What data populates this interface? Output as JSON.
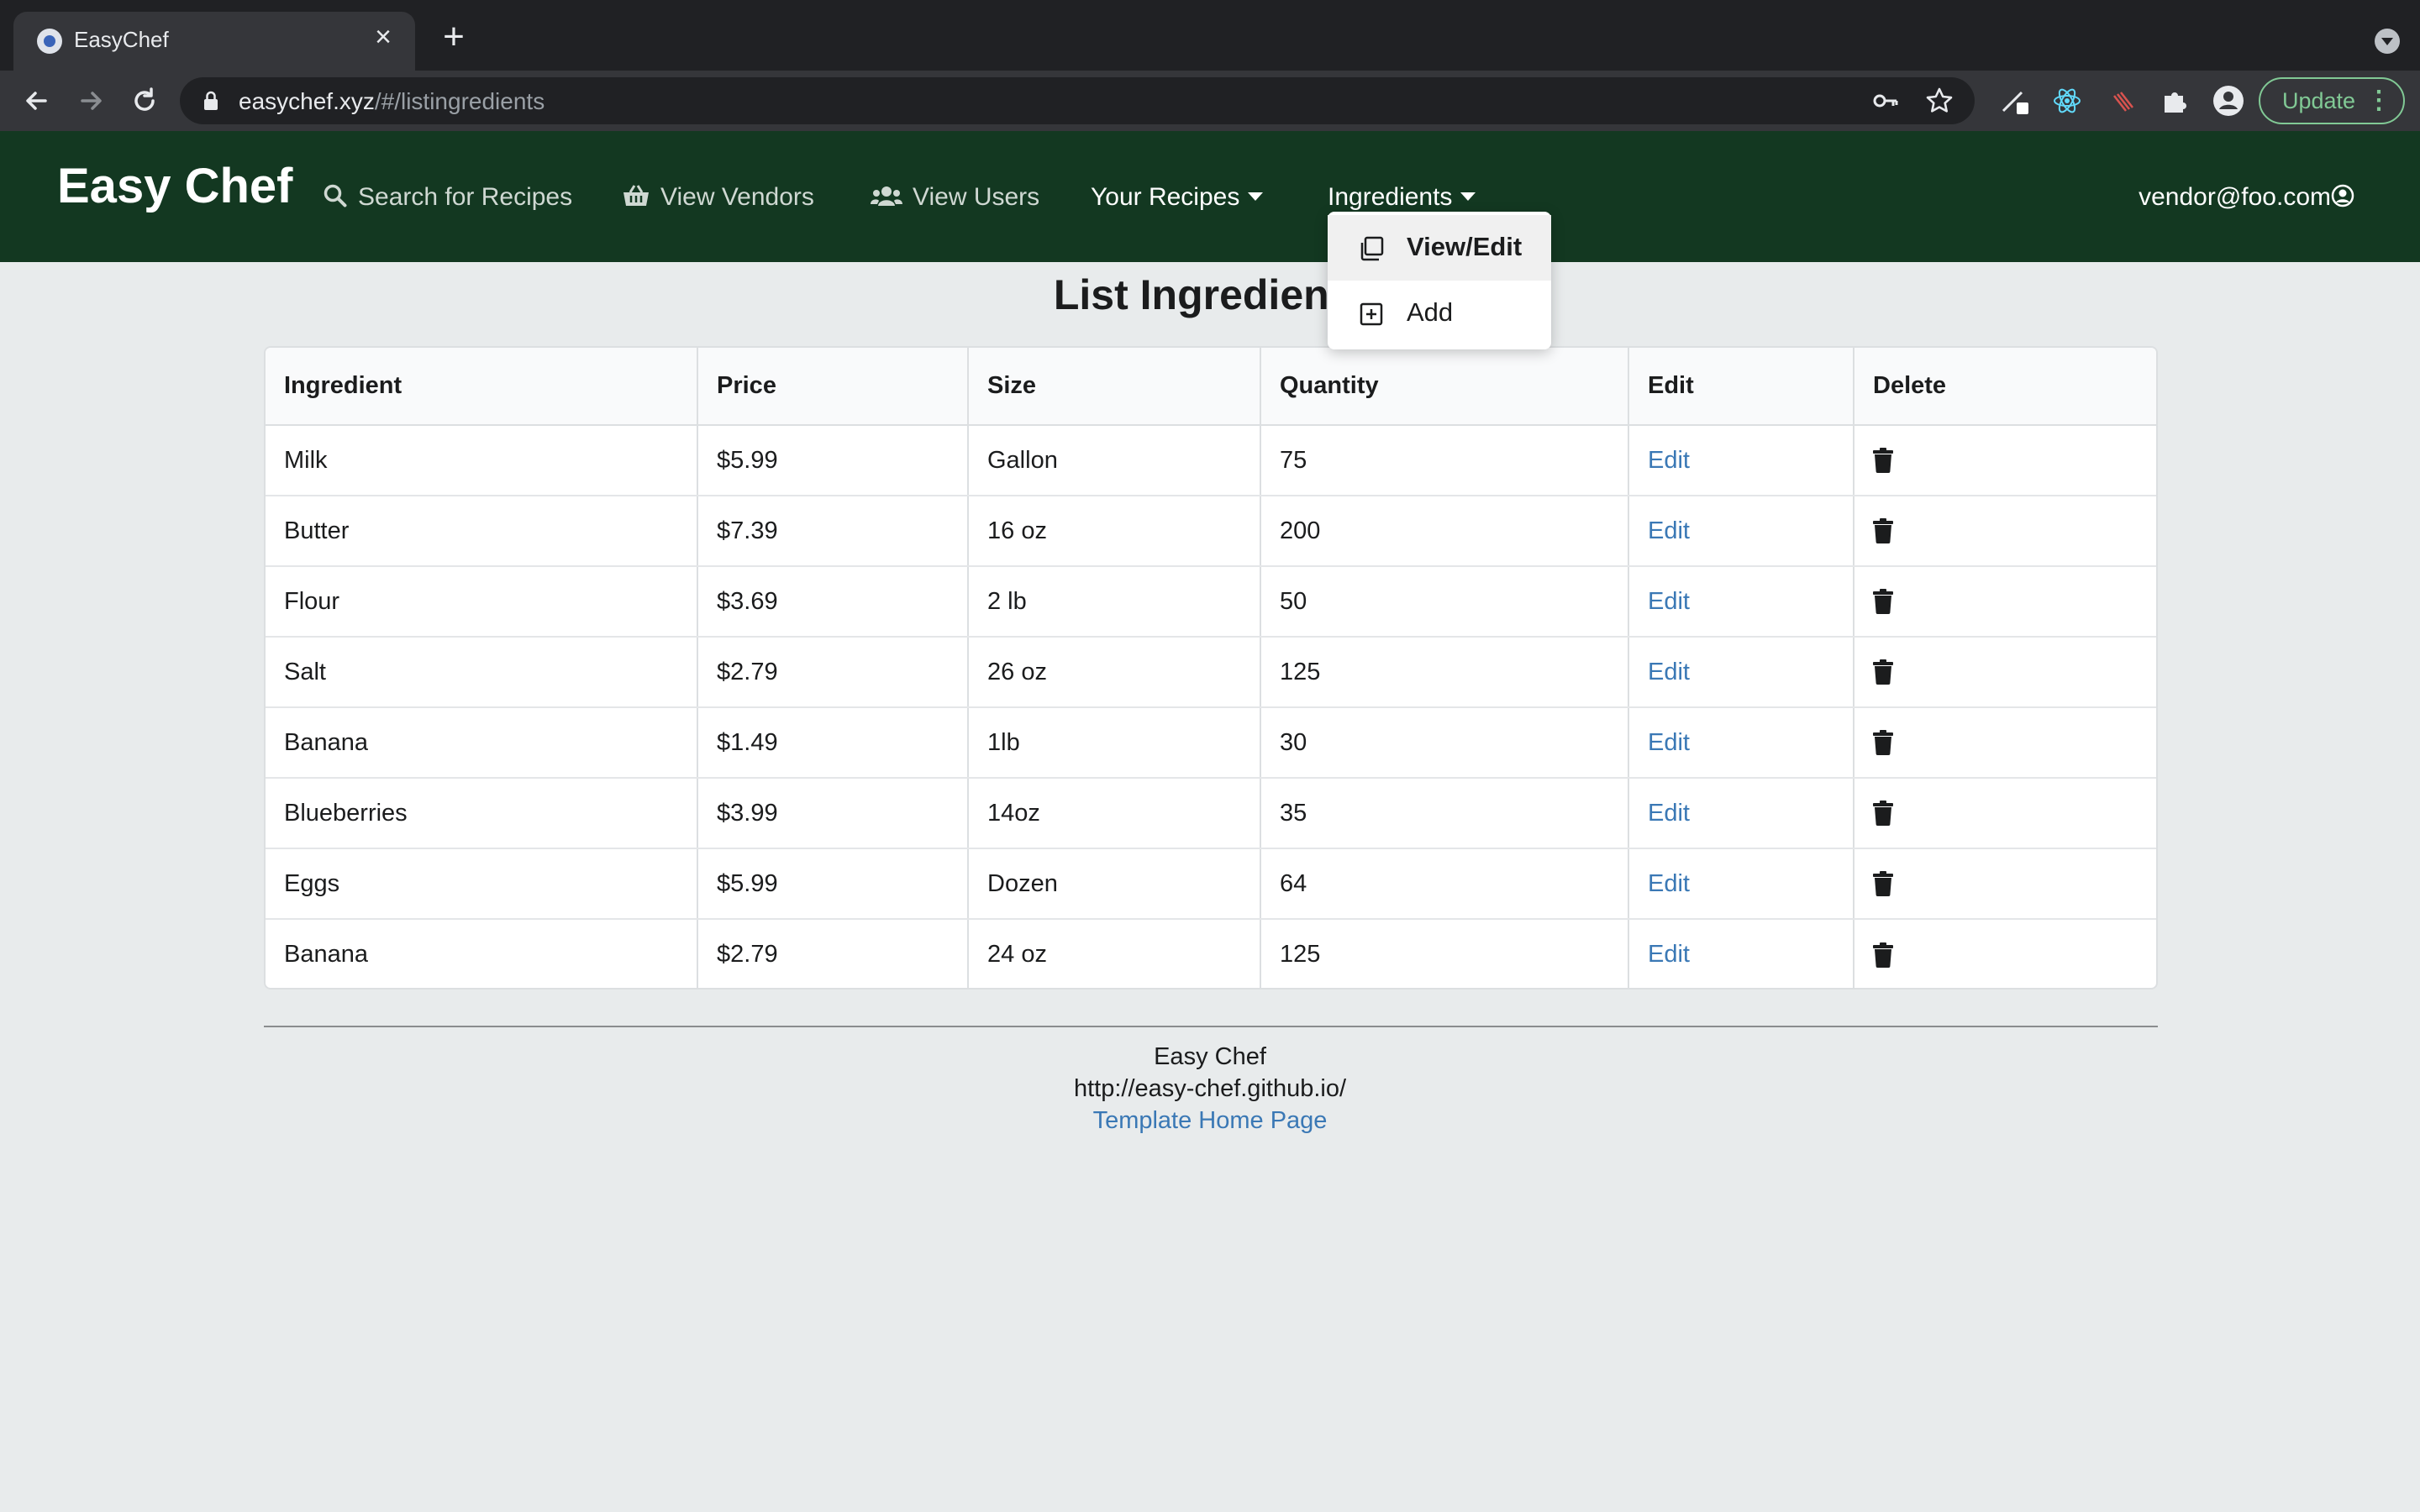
{
  "browser": {
    "tab_title": "EasyChef",
    "url_host": "easychef.xyz",
    "url_path": "/#/listingredients",
    "update_label": "Update"
  },
  "navbar": {
    "brand": "Easy Chef",
    "items": [
      {
        "label": "Search for Recipes",
        "icon": "search-icon"
      },
      {
        "label": "View Vendors",
        "icon": "basket-icon"
      },
      {
        "label": "View Users",
        "icon": "users-icon"
      },
      {
        "label": "Your Recipes",
        "icon": "caret-down-icon"
      },
      {
        "label": "Ingredients",
        "icon": "caret-down-icon"
      }
    ],
    "user": "vendor@foo.com"
  },
  "dropdown": {
    "items": [
      {
        "label": "View/Edit",
        "icon": "copy-icon"
      },
      {
        "label": "Add",
        "icon": "plus-square-icon"
      }
    ]
  },
  "page": {
    "title": "List Ingredients"
  },
  "table": {
    "headers": [
      "Ingredient",
      "Price",
      "Size",
      "Quantity",
      "Edit",
      "Delete"
    ],
    "rows": [
      {
        "ingredient": "Milk",
        "price": "$5.99",
        "size": "Gallon",
        "quantity": "75",
        "edit": "Edit"
      },
      {
        "ingredient": "Butter",
        "price": "$7.39",
        "size": "16 oz",
        "quantity": "200",
        "edit": "Edit"
      },
      {
        "ingredient": "Flour",
        "price": "$3.69",
        "size": "2 lb",
        "quantity": "50",
        "edit": "Edit"
      },
      {
        "ingredient": "Salt",
        "price": "$2.79",
        "size": "26 oz",
        "quantity": "125",
        "edit": "Edit"
      },
      {
        "ingredient": "Banana",
        "price": "$1.49",
        "size": "1lb",
        "quantity": "30",
        "edit": "Edit"
      },
      {
        "ingredient": "Blueberries",
        "price": "$3.99",
        "size": "14oz",
        "quantity": "35",
        "edit": "Edit"
      },
      {
        "ingredient": "Eggs",
        "price": "$5.99",
        "size": "Dozen",
        "quantity": "64",
        "edit": "Edit"
      },
      {
        "ingredient": "Banana",
        "price": "$2.79",
        "size": "24 oz",
        "quantity": "125",
        "edit": "Edit"
      }
    ]
  },
  "footer": {
    "name": "Easy Chef",
    "url": "http://easy-chef.github.io/",
    "link": "Template Home Page"
  },
  "colors": {
    "navbar": "#133821",
    "link": "#3a78b5",
    "page_bg": "#e8ebec"
  }
}
